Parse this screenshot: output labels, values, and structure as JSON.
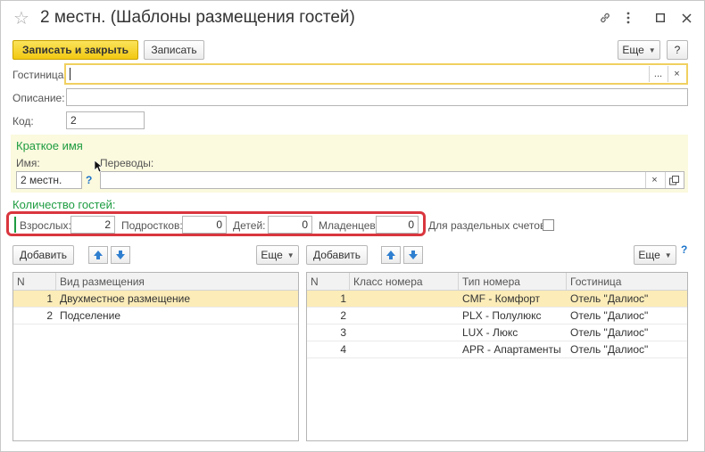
{
  "window": {
    "title": "2 местн. (Шаблоны размещения гостей)"
  },
  "toolbar": {
    "save_close_label": "Записать и закрыть",
    "save_label": "Записать",
    "more_label": "Еще",
    "help_label": "?"
  },
  "form": {
    "hotel_label": "Гостиница:",
    "hotel_value": "",
    "hotel_select_btn": "...",
    "hotel_clear_btn": "×",
    "description_label": "Описание:",
    "description_value": "",
    "code_label": "Код:",
    "code_value": "2"
  },
  "short_name": {
    "title": "Краткое имя",
    "name_label": "Имя:",
    "name_value": "2 местн.",
    "help": "?",
    "translations_label": "Переводы:",
    "translations_value": "",
    "clear_btn": "×"
  },
  "guests": {
    "title": "Количество гостей:",
    "adults_label": "Взрослых:",
    "adults_value": "2",
    "teens_label": "Подростков:",
    "teens_value": "0",
    "children_label": "Детей:",
    "children_value": "0",
    "infants_label": "Младенцев:",
    "infants_value": "0",
    "separate_bills_label": "Для раздельных счетов:"
  },
  "left_panel": {
    "add_label": "Добавить",
    "more_label": "Еще",
    "columns": [
      "N",
      "Вид размещения"
    ],
    "rows": [
      {
        "n": "1",
        "type": "Двухместное размещение"
      },
      {
        "n": "2",
        "type": "Подселение"
      }
    ]
  },
  "right_panel": {
    "add_label": "Добавить",
    "more_label": "Еще",
    "help": "?",
    "columns": [
      "N",
      "Класс номера",
      "Тип номера",
      "Гостиница"
    ],
    "rows": [
      {
        "n": "1",
        "class": "",
        "room_type": "CMF - Комфорт",
        "hotel": "Отель \"Далиос\""
      },
      {
        "n": "2",
        "class": "",
        "room_type": "PLX - Полулюкс",
        "hotel": "Отель \"Далиос\""
      },
      {
        "n": "3",
        "class": "",
        "room_type": "LUX - Люкс",
        "hotel": "Отель \"Далиос\""
      },
      {
        "n": "4",
        "class": "",
        "room_type": "APR - Апартаменты",
        "hotel": "Отель \"Далиос\""
      }
    ]
  },
  "colors": {
    "accent_yellow": "#f2c912",
    "section_bg": "#fbf9de",
    "green": "#1e9c41",
    "highlight_red": "#d9363e",
    "selected_row": "#fbecb8"
  }
}
